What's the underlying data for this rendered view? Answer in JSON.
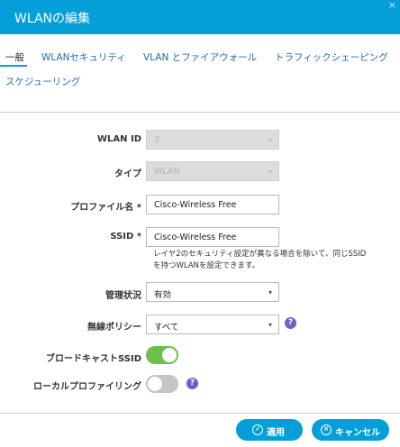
{
  "dialog": {
    "title": "WLANの編集",
    "close_glyph": "×"
  },
  "tabs": [
    {
      "label": "一般"
    },
    {
      "label": "WLANセキュリティ"
    },
    {
      "label": "VLAN とファイアウォール"
    },
    {
      "label": "トラフィックシェーピング"
    },
    {
      "label": "スケジューリング"
    }
  ],
  "form": {
    "wlan_id": {
      "label": "WLAN ID",
      "value": "3"
    },
    "type": {
      "label": "タイプ",
      "value": "WLAN"
    },
    "profile_name": {
      "label": "プロファイル名 *",
      "value": "Cisco-Wireless Free"
    },
    "ssid": {
      "label": "SSID *",
      "value": "Cisco-Wireless Free",
      "note": "レイヤ2のセキュリティ設定が異なる場合を除いて、同じSSIDを持つWLANを設定できます。"
    },
    "admin_status": {
      "label": "管理状況",
      "value": "有効"
    },
    "radio_policy": {
      "label": "無線ポリシー",
      "value": "すべて"
    },
    "broadcast_ssid": {
      "label": "ブロードキャストSSID",
      "enabled": true
    },
    "local_profiling": {
      "label": "ローカルプロファイリング",
      "enabled": false
    }
  },
  "icons": {
    "caret": "▾",
    "help": "?",
    "apply": "✓",
    "cancel": "✕"
  },
  "buttons": {
    "apply": "適用",
    "cancel": "キャンセル"
  },
  "colors": {
    "header": "#049fd9",
    "toggle_on": "#6cc04a",
    "help_icon": "#6c5fc7",
    "link": "#1a6fa8"
  }
}
